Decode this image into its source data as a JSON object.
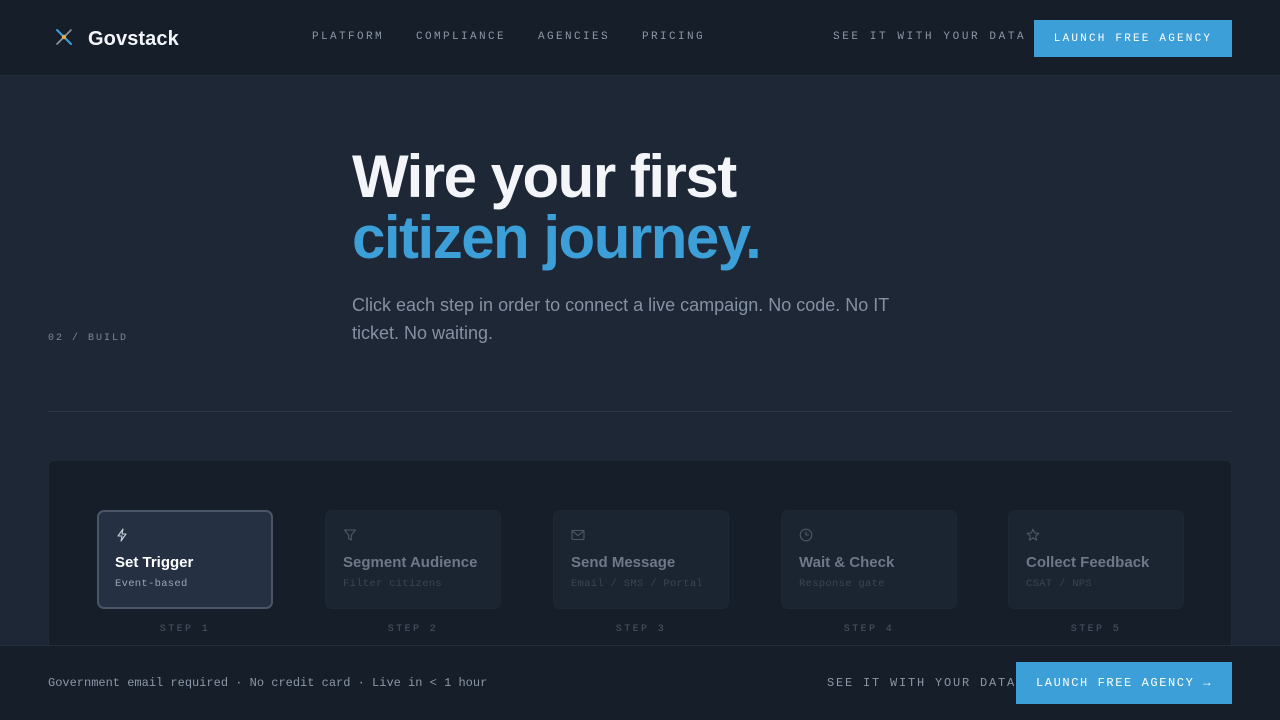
{
  "header": {
    "brand": "Govstack",
    "logo_icon": "sparkle-compass-icon",
    "nav": [
      "PLATFORM",
      "COMPLIANCE",
      "AGENCIES",
      "PRICING"
    ],
    "secondary_link": "SEE IT WITH YOUR DATA",
    "cta": "LAUNCH FREE AGENCY"
  },
  "hero": {
    "section_label": "02 / BUILD",
    "title_line1": "Wire your first",
    "title_line2": "citizen journey.",
    "subtitle": "Click each step in order to connect a live campaign. No code. No IT ticket. No waiting."
  },
  "steps": [
    {
      "icon": "bolt-icon",
      "title": "Set Trigger",
      "subtitle": "Event-based",
      "step_label": "STEP 1",
      "active": true
    },
    {
      "icon": "filter-icon",
      "title": "Segment Audience",
      "subtitle": "Filter citizens",
      "step_label": "STEP 2",
      "active": false
    },
    {
      "icon": "mail-icon",
      "title": "Send Message",
      "subtitle": "Email / SMS / Portal",
      "step_label": "STEP 3",
      "active": false
    },
    {
      "icon": "clock-icon",
      "title": "Wait & Check",
      "subtitle": "Response gate",
      "step_label": "STEP 4",
      "active": false
    },
    {
      "icon": "star-icon",
      "title": "Collect Feedback",
      "subtitle": "CSAT / NPS",
      "step_label": "STEP 5",
      "active": false
    }
  ],
  "footer": {
    "note": "Government email required · No credit card · Live in < 1 hour",
    "secondary_link": "SEE IT WITH YOUR DATA",
    "cta": "LAUNCH FREE AGENCY →"
  },
  "colors": {
    "accent": "#3d9fd8",
    "background": "#1d2735",
    "header_bg": "#161e29"
  }
}
